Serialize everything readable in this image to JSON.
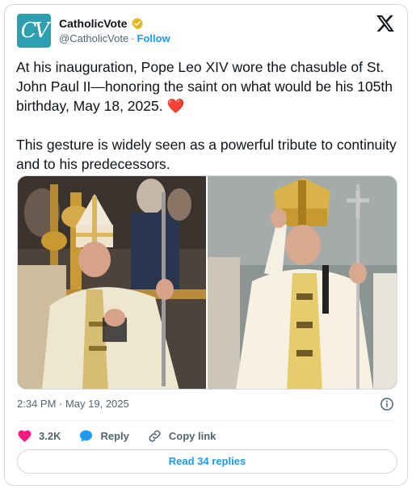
{
  "author": {
    "display_name": "CatholicVote",
    "handle": "@CatholicVote",
    "separator": "·",
    "follow_label": "Follow",
    "avatar_letters": "CV",
    "avatar_color": "#2e9fb0",
    "verified_badge_color": "#e2b719"
  },
  "tweet": {
    "text_p1": "At his inauguration, Pope Leo XIV wore the chasuble of St. John Paul II—honoring the saint on what would be his 105th birthday, May 18, 2025. ",
    "heart_emoji": "❤️",
    "text_p2": "This gesture is widely seen as a powerful tribute to continuity and to his predecessors.",
    "timestamp": "2:34 PM · May 19, 2025"
  },
  "media": {
    "photo_count": 2,
    "icons": [
      "pope-leo-photo",
      "john-paul-ii-photo"
    ]
  },
  "actions": {
    "like_count": "3.2K",
    "reply_label": "Reply",
    "copy_link_label": "Copy link",
    "read_replies_label": "Read 34 replies"
  },
  "colors": {
    "accent": "#1d9bf0",
    "like": "#f91880",
    "secondary_text": "#536471"
  }
}
